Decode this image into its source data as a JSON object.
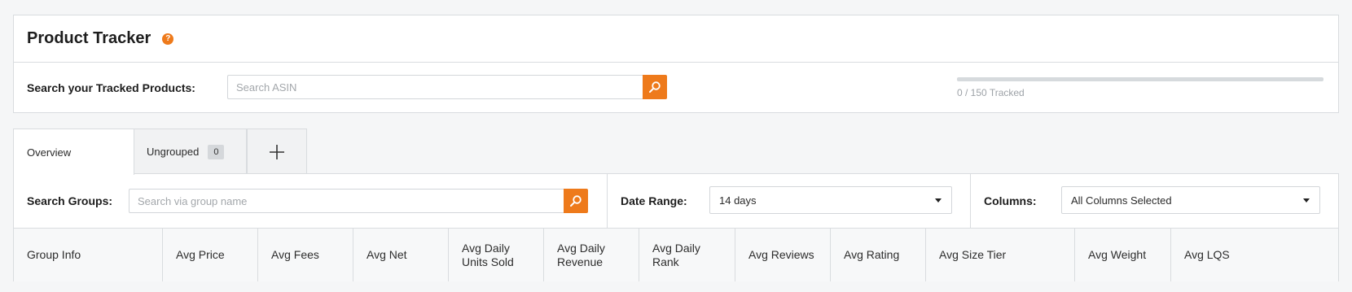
{
  "header": {
    "title": "Product Tracker",
    "help_icon": "question-circle-icon",
    "search_label": "Search your Tracked Products:",
    "search_placeholder": "Search ASIN",
    "search_icon": "magnifier-icon",
    "tracked_text": "0 / 150 Tracked",
    "tracked_fraction": 0
  },
  "tabs": {
    "overview": "Overview",
    "ungrouped": "Ungrouped",
    "ungrouped_count": "0",
    "add": "+"
  },
  "filters": {
    "groups_label": "Search Groups:",
    "groups_placeholder": "Search via group name",
    "date_label": "Date Range:",
    "date_value": "14 days",
    "columns_label": "Columns:",
    "columns_value": "All Columns Selected"
  },
  "table": {
    "columns": [
      "Group Info",
      "Avg Price",
      "Avg Fees",
      "Avg Net",
      "Avg Daily Units Sold",
      "Avg Daily Revenue",
      "Avg Daily Rank",
      "Avg Reviews",
      "Avg Rating",
      "Avg Size Tier",
      "Avg Weight",
      "Avg LQS"
    ]
  },
  "colors": {
    "accent": "#ee7a1b",
    "border": "#d9dcdf",
    "background": "#f5f6f7"
  }
}
